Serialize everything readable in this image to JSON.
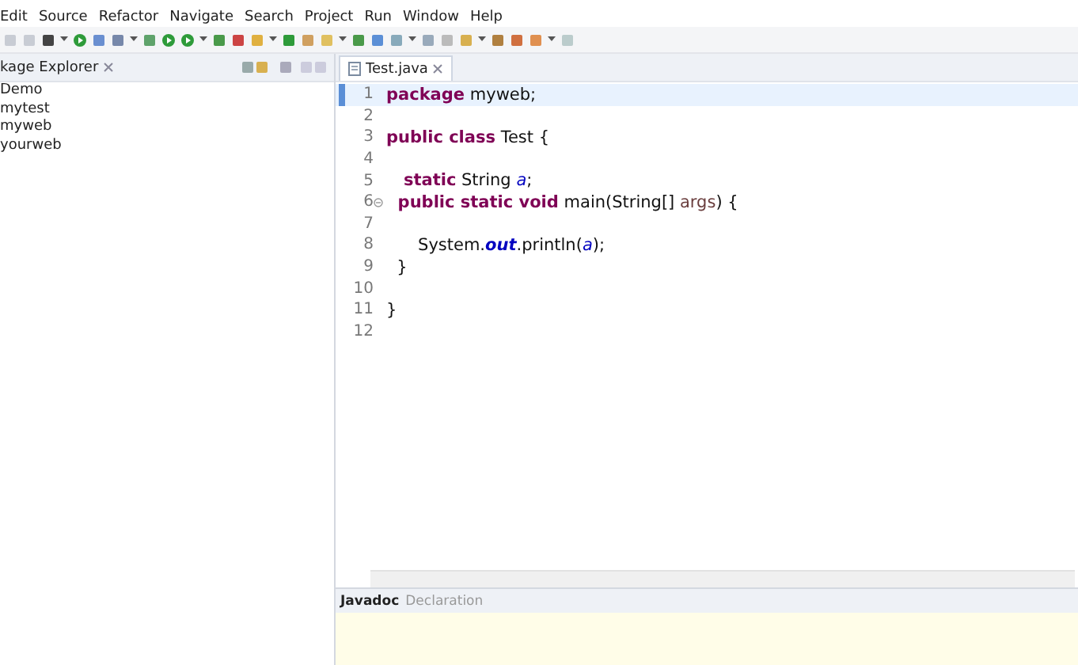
{
  "menu": [
    "Edit",
    "Source",
    "Refactor",
    "Navigate",
    "Search",
    "Project",
    "Run",
    "Window",
    "Help"
  ],
  "left_panel": {
    "tab": "kage Explorer",
    "items": [
      "Demo",
      "mytest",
      "myweb",
      "yourweb"
    ]
  },
  "editor": {
    "tab": "Test.java",
    "lines": [
      {
        "number": "1",
        "current": true,
        "foldable": false,
        "tokens": [
          {
            "kind": "keyword",
            "text": "package"
          },
          {
            "kind": "plain",
            "text": " myweb;"
          }
        ]
      },
      {
        "number": "2",
        "current": false,
        "foldable": false
      },
      {
        "number": "3",
        "current": false,
        "foldable": false,
        "tokens": [
          {
            "kind": "keyword",
            "text": "public class"
          },
          {
            "kind": "plain",
            "text": " Test {"
          }
        ]
      },
      {
        "number": "4",
        "current": false,
        "foldable": false
      },
      {
        "number": "5",
        "current": false,
        "foldable": false,
        "tokens": [
          {
            "kind": "keyword",
            "text": "   static"
          },
          {
            "kind": "plain",
            "text": " String "
          },
          {
            "kind": "field",
            "text": "a"
          },
          {
            "kind": "plain",
            "text": ";"
          }
        ]
      },
      {
        "number": "6",
        "current": false,
        "foldable": true,
        "tokens": [
          {
            "kind": "keyword",
            "text": "  public static void"
          },
          {
            "kind": "plain",
            "text": " main(String[] "
          },
          {
            "kind": "param",
            "text": "args"
          },
          {
            "kind": "plain",
            "text": ") {"
          }
        ]
      },
      {
        "number": "7",
        "current": false,
        "foldable": false
      },
      {
        "number": "8",
        "current": false,
        "foldable": false,
        "tokens": [
          {
            "kind": "plain",
            "text": "      System."
          },
          {
            "kind": "static_field",
            "text": "out"
          },
          {
            "kind": "plain",
            "text": ".println("
          },
          {
            "kind": "field",
            "text": "a"
          },
          {
            "kind": "plain",
            "text": ");"
          }
        ]
      },
      {
        "number": "9",
        "current": false,
        "foldable": false,
        "tokens": [
          {
            "kind": "plain",
            "text": "  }"
          }
        ]
      },
      {
        "number": "10",
        "current": false,
        "foldable": false
      },
      {
        "number": "11",
        "current": false,
        "foldable": false,
        "tokens": [
          {
            "kind": "plain",
            "text": "}"
          }
        ]
      },
      {
        "number": "12",
        "current": false,
        "foldable": false
      }
    ]
  },
  "bottom_panel": {
    "tabs": [
      {
        "label": "Javadoc",
        "selected": true
      },
      {
        "label": "Declaration",
        "selected": false
      }
    ]
  }
}
